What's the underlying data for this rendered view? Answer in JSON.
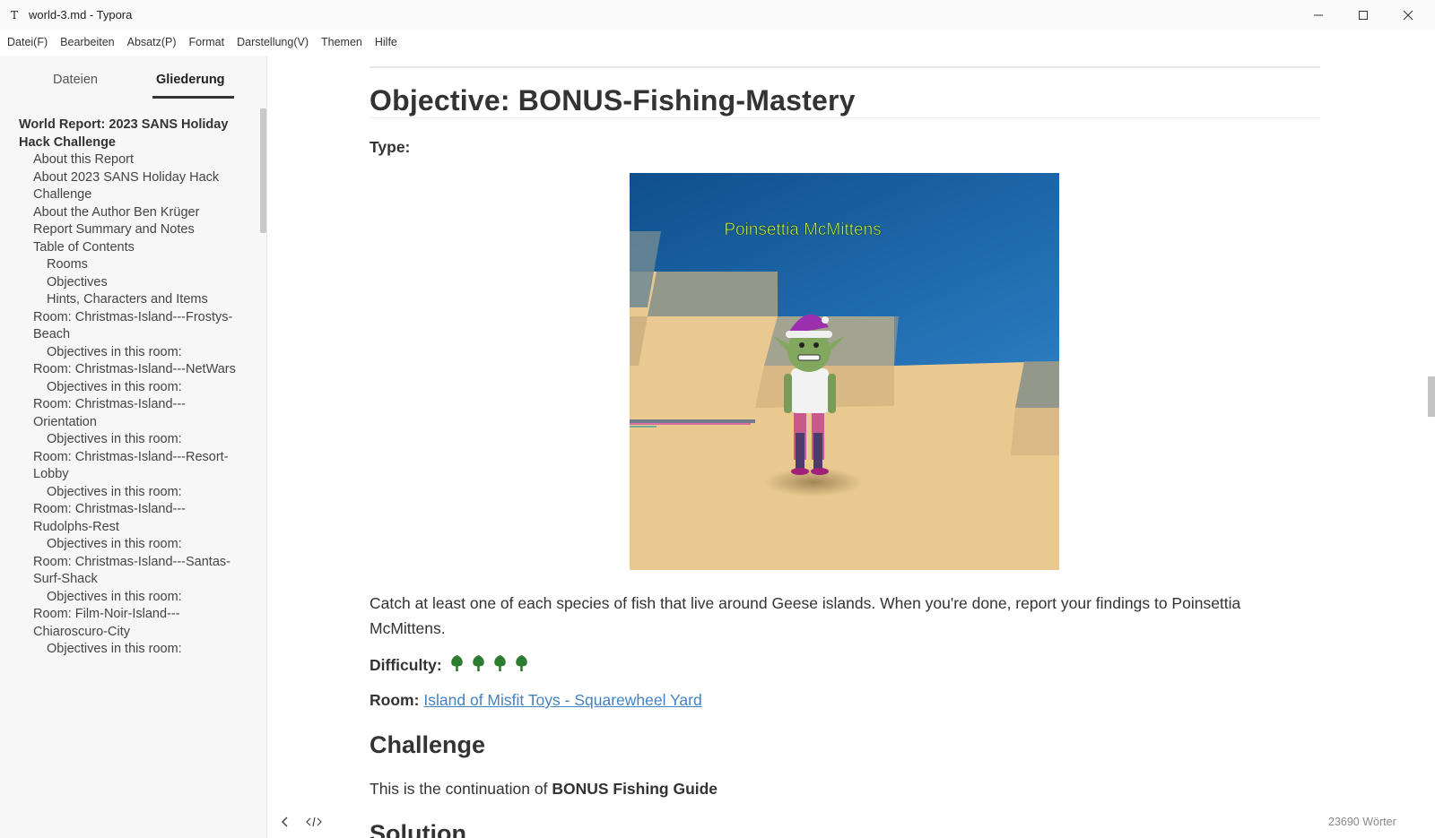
{
  "window": {
    "title": "world-3.md - Typora",
    "app_icon_letter": "T"
  },
  "menu": [
    "Datei(F)",
    "Bearbeiten",
    "Absatz(P)",
    "Format",
    "Darstellung(V)",
    "Themen",
    "Hilfe"
  ],
  "sidebar": {
    "tabs": {
      "files": "Dateien",
      "outline": "Gliederung"
    },
    "active_tab": "Gliederung",
    "outline": [
      {
        "level": 1,
        "text": "World Report: 2023 SANS Holiday Hack Challenge"
      },
      {
        "level": 2,
        "text": "About this Report"
      },
      {
        "level": 2,
        "text": "About 2023 SANS Holiday Hack Challenge"
      },
      {
        "level": 2,
        "text": "About the Author Ben Krüger"
      },
      {
        "level": 2,
        "text": "Report Summary and Notes"
      },
      {
        "level": 2,
        "text": "Table of Contents"
      },
      {
        "level": 3,
        "text": "Rooms"
      },
      {
        "level": 3,
        "text": "Objectives"
      },
      {
        "level": 3,
        "text": "Hints, Characters and Items"
      },
      {
        "level": 2,
        "text": "Room: Christmas-Island---Frostys-Beach"
      },
      {
        "level": 3,
        "text": "Objectives in this room:"
      },
      {
        "level": 2,
        "text": "Room: Christmas-Island---NetWars"
      },
      {
        "level": 3,
        "text": "Objectives in this room:"
      },
      {
        "level": 2,
        "text": "Room: Christmas-Island---Orientation"
      },
      {
        "level": 3,
        "text": "Objectives in this room:"
      },
      {
        "level": 2,
        "text": "Room: Christmas-Island---Resort-Lobby"
      },
      {
        "level": 3,
        "text": "Objectives in this room:"
      },
      {
        "level": 2,
        "text": "Room: Christmas-Island---Rudolphs-Rest"
      },
      {
        "level": 3,
        "text": "Objectives in this room:"
      },
      {
        "level": 2,
        "text": "Room: Christmas-Island---Santas-Surf-Shack"
      },
      {
        "level": 3,
        "text": "Objectives in this room:"
      },
      {
        "level": 2,
        "text": "Room: Film-Noir-Island---Chiaroscuro-City"
      },
      {
        "level": 3,
        "text": "Objectives in this room:"
      }
    ]
  },
  "document": {
    "heading": "Objective: BONUS-Fishing-Mastery",
    "type_label": "Type:",
    "image_caption": "Poinsettia McMittens",
    "description": "Catch at least one of each species of fish that live around Geese islands. When you're done, report your findings to Poinsettia McMittens.",
    "difficulty_label": "Difficulty:",
    "difficulty_level": 4,
    "difficulty_icon": "tree-icon",
    "room_label": "Room:",
    "room_link": "Island of Misfit Toys - Squarewheel Yard",
    "challenge_heading": "Challenge",
    "continuation_prefix": "This is the continuation of ",
    "continuation_bold": "BONUS Fishing Guide",
    "solution_heading": "Solution"
  },
  "status": {
    "word_count": "23690 Wörter"
  },
  "colors": {
    "link": "#4183c4",
    "tree": "#2e7d32",
    "water": "#1c66a8",
    "sand": "#e9c98f"
  }
}
